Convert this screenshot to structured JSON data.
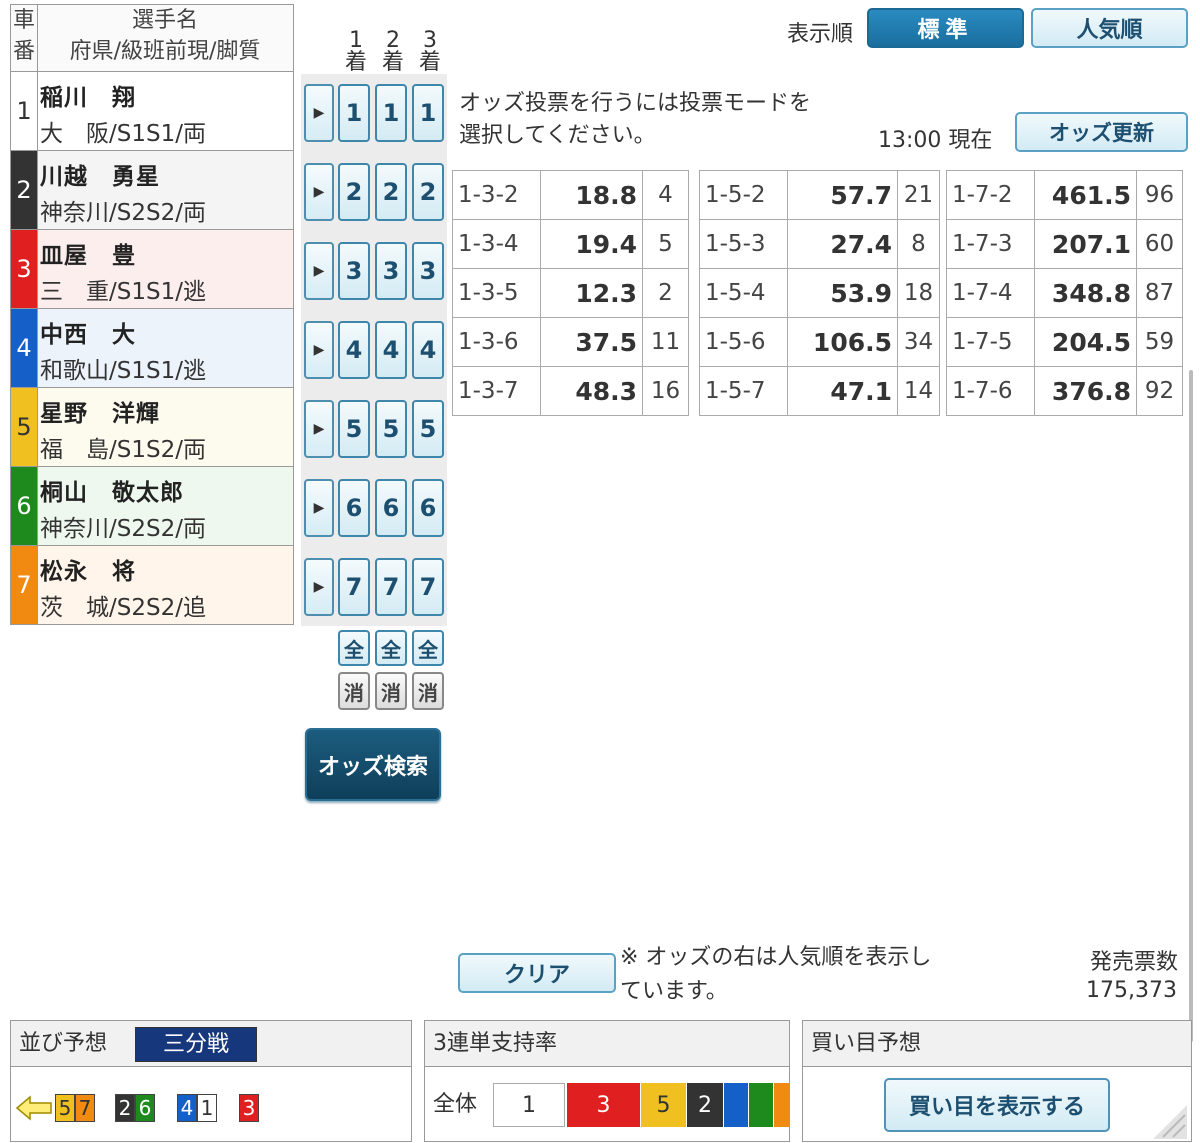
{
  "racer_table": {
    "head_car_1": "車",
    "head_car_2": "番",
    "head_name": "選手名",
    "head_info": "府県/級班前現/脚質",
    "racers": [
      {
        "num": "1",
        "name": "稲川　翔",
        "info": "大　阪/S1S1/両",
        "color": "#ffffff",
        "num_color": "#333333",
        "row_bg": "#ffffff"
      },
      {
        "num": "2",
        "name": "川越　勇星",
        "info": "神奈川/S2S2/両",
        "color": "#333333",
        "num_color": "#ffffff",
        "row_bg": "#f4f4f4"
      },
      {
        "num": "3",
        "name": "皿屋　豊",
        "info": "三　重/S1S1/逃",
        "color": "#e02020",
        "num_color": "#ffffff",
        "row_bg": "#fdeeee"
      },
      {
        "num": "4",
        "name": "中西　大",
        "info": "和歌山/S1S1/逃",
        "color": "#1560c8",
        "num_color": "#ffffff",
        "row_bg": "#edf3fb"
      },
      {
        "num": "5",
        "name": "星野　洋輝",
        "info": "福　島/S1S2/両",
        "color": "#f0c020",
        "num_color": "#333333",
        "row_bg": "#fdfaee"
      },
      {
        "num": "6",
        "name": "桐山　敬太郎",
        "info": "神奈川/S2S2/両",
        "color": "#1e8a1e",
        "num_color": "#ffffff",
        "row_bg": "#eef8ee"
      },
      {
        "num": "7",
        "name": "松永　将",
        "info": "茨　城/S2S2/追",
        "color": "#f08a10",
        "num_color": "#ffffff",
        "row_bg": "#fff5ea"
      }
    ]
  },
  "selector": {
    "col_heads": [
      {
        "num": "1",
        "suffix": "着"
      },
      {
        "num": "2",
        "suffix": "着"
      },
      {
        "num": "3",
        "suffix": "着"
      }
    ],
    "rows": [
      "1",
      "2",
      "3",
      "4",
      "5",
      "6",
      "7"
    ],
    "all_label": "全",
    "clear_label": "消",
    "search_label": "オッズ検索"
  },
  "controls": {
    "order_label": "表示順",
    "standard_label": "標準",
    "popular_label": "人気順",
    "message_line1": "オッズ投票を行うには投票モードを",
    "message_line2": "選択してください。",
    "time": "13:00 現在",
    "refresh_label": "オッズ更新"
  },
  "odds_tables": [
    {
      "rows": [
        [
          "1-3-2",
          "18.8",
          "4"
        ],
        [
          "1-3-4",
          "19.4",
          "5"
        ],
        [
          "1-3-5",
          "12.3",
          "2"
        ],
        [
          "1-3-6",
          "37.5",
          "11"
        ],
        [
          "1-3-7",
          "48.3",
          "16"
        ]
      ]
    },
    {
      "rows": [
        [
          "1-5-2",
          "57.7",
          "21"
        ],
        [
          "1-5-3",
          "27.4",
          "8"
        ],
        [
          "1-5-4",
          "53.9",
          "18"
        ],
        [
          "1-5-6",
          "106.5",
          "34"
        ],
        [
          "1-5-7",
          "47.1",
          "14"
        ]
      ]
    },
    {
      "rows": [
        [
          "1-7-2",
          "461.5",
          "96"
        ],
        [
          "1-7-3",
          "207.1",
          "60"
        ],
        [
          "1-7-4",
          "348.8",
          "87"
        ],
        [
          "1-7-5",
          "204.5",
          "59"
        ],
        [
          "1-7-6",
          "376.8",
          "92"
        ]
      ]
    }
  ],
  "bottom": {
    "clear_label": "クリア",
    "note_line1": "※ オッズの右は人気順を表示し",
    "note_line2": "ています。",
    "sales_label": "発売票数",
    "sales_value": "175,373"
  },
  "lineup": {
    "title": "並び予想",
    "badge": "三分戦",
    "groups": [
      {
        "tags": [
          {
            "n": "5",
            "bg": "#f0c020",
            "fg": "#333333"
          },
          {
            "n": "7",
            "bg": "#f08a10",
            "fg": "#333333"
          }
        ]
      },
      {
        "tags": [
          {
            "n": "2",
            "bg": "#333333",
            "fg": "#ffffff"
          },
          {
            "n": "6",
            "bg": "#1e8a1e",
            "fg": "#ffffff"
          }
        ]
      },
      {
        "tags": [
          {
            "n": "4",
            "bg": "#1560c8",
            "fg": "#ffffff"
          },
          {
            "n": "1",
            "bg": "#ffffff",
            "fg": "#333333"
          }
        ]
      },
      {
        "tags": [
          {
            "n": "3",
            "bg": "#e02020",
            "fg": "#ffffff"
          }
        ]
      }
    ]
  },
  "support": {
    "title": "3連単支持率",
    "overall_label": "全体",
    "bars": [
      {
        "n": "1",
        "bg": "#ffffff",
        "fg": "#333333"
      },
      {
        "n": "3",
        "bg": "#e02020",
        "fg": "#ffffff"
      },
      {
        "n": "5",
        "bg": "#f0c020",
        "fg": "#333333"
      },
      {
        "n": "2",
        "bg": "#333333",
        "fg": "#ffffff"
      },
      {
        "n": "",
        "bg": "#1560c8",
        "fg": "#ffffff"
      },
      {
        "n": "",
        "bg": "#1e8a1e",
        "fg": "#ffffff"
      },
      {
        "n": "",
        "bg": "#f08a10",
        "fg": "#ffffff"
      }
    ]
  },
  "prediction": {
    "title": "買い目予想",
    "button_label": "買い目を表示する"
  }
}
